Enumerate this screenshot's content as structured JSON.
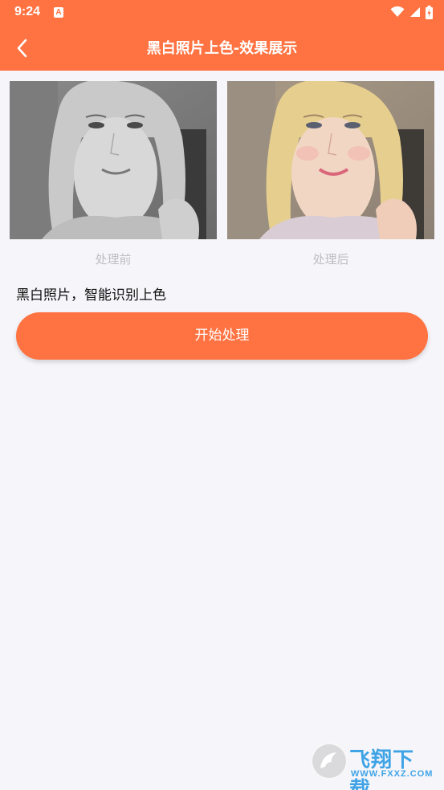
{
  "status_bar": {
    "time": "9:24",
    "notification_icon": "A",
    "icons": [
      "wifi-icon",
      "cellular-signal-icon",
      "battery-icon"
    ]
  },
  "header": {
    "back_icon": "chevron-left-icon",
    "title": "黑白照片上色-效果展示"
  },
  "comparison": {
    "before_caption": "处理前",
    "after_caption": "处理后"
  },
  "description": "黑白照片，智能识别上色",
  "action": {
    "start_label": "开始处理"
  },
  "watermark": {
    "text": "飞翔下载",
    "url": "WWW.FXXZ.COM"
  },
  "colors": {
    "accent": "#FF7342",
    "background": "#F6F6FA",
    "caption": "#BDBDC2"
  }
}
